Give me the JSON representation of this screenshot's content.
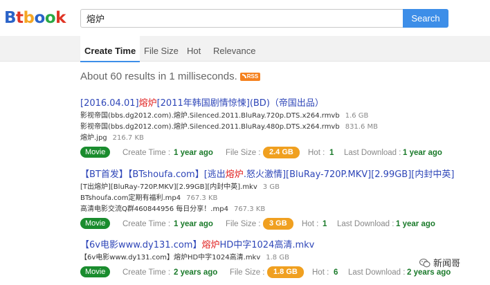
{
  "logo": {
    "letters": [
      "B",
      "t",
      "b",
      "o",
      "o",
      "k"
    ],
    "colors": [
      "#2a63c8",
      "#e03424",
      "#f5a623",
      "#2a63c8",
      "#2aa844",
      "#e03424"
    ]
  },
  "search": {
    "query": "熔炉",
    "button_label": "Search"
  },
  "tabs": [
    {
      "label": "Create Time",
      "active": true
    },
    {
      "label": "File Size",
      "active": false
    },
    {
      "label": "Hot",
      "active": false
    },
    {
      "label": "Relevance",
      "active": false
    }
  ],
  "summary": {
    "text": "About 60 results in 1 milliseconds.",
    "rss_label": "RSS"
  },
  "meta_labels": {
    "create_time": "Create Time :",
    "file_size": "File Size :",
    "hot": "Hot :",
    "last_download": "Last Download :"
  },
  "results": [
    {
      "title_parts": [
        {
          "text": "[2016.04.01]",
          "highlight": false
        },
        {
          "text": "熔炉",
          "highlight": true
        },
        {
          "text": "[2011年韩国剧情惊悚](BD)（帝国出品）",
          "highlight": false
        }
      ],
      "files": [
        {
          "name": "影视帝国(bbs.dg2012.com).熔炉.Silenced.2011.BluRay.720p.DTS.x264.rmvb",
          "size": "1.6 GB"
        },
        {
          "name": "影视帝国(bbs.dg2012.com).熔炉.Silenced.2011.BluRay.480p.DTS.x264.rmvb",
          "size": "831.6 MB"
        },
        {
          "name": "熔炉.jpg",
          "size": "216.7 KB"
        }
      ],
      "category": "Movie",
      "create_time": "1 year ago",
      "file_size": "2.4 GB",
      "hot": "1",
      "last_download": "1 year ago"
    },
    {
      "title_parts": [
        {
          "text": "【BT首发】【BTshoufa.com】[逃出",
          "highlight": false
        },
        {
          "text": "熔炉",
          "highlight": true
        },
        {
          "text": ".怒火激情][BluRay-720P.MKV][2.99GB][内封中英]",
          "highlight": false
        }
      ],
      "files": [
        {
          "name": "[T出熔炉][BluRay-720P.MKV][2.99GB][内封中英].mkv",
          "size": "3 GB"
        },
        {
          "name": "BTshoufa.com定期有福利.mp4",
          "size": "767.3 KB"
        },
        {
          "name": "高清电影交流Q群460844956 每日分享！.mp4",
          "size": "767.3 KB"
        }
      ],
      "category": "Movie",
      "create_time": "1 year ago",
      "file_size": "3 GB",
      "hot": "1",
      "last_download": "1 year ago"
    },
    {
      "title_parts": [
        {
          "text": "【6v电影www.dy131.com】",
          "highlight": false
        },
        {
          "text": "熔炉",
          "highlight": true
        },
        {
          "text": "HD中字1024高清.mkv",
          "highlight": false
        }
      ],
      "files": [
        {
          "name": "【6v电影www.dy131.com】熔炉HD中字1024高清.mkv",
          "size": "1.8 GB"
        }
      ],
      "category": "Movie",
      "create_time": "2 years ago",
      "file_size": "1.8 GB",
      "hot": "6",
      "last_download": "2 years ago"
    }
  ],
  "watermark": {
    "text": "新闻哥"
  },
  "theme": {
    "accent": "#3d8ee8",
    "link": "#2e46b8",
    "highlight": "#e0201f",
    "badge_green": "#1a8c2e",
    "badge_orange": "#f0a020"
  }
}
